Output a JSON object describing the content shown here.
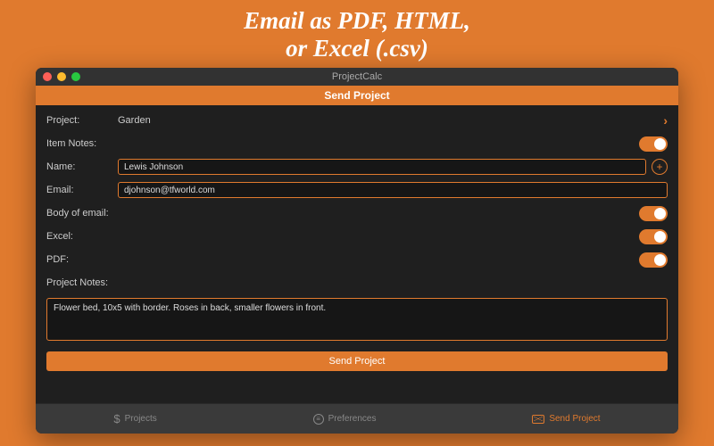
{
  "promo": {
    "line1": "Email as PDF, HTML,",
    "line2": "or Excel (.csv)"
  },
  "window": {
    "title": "ProjectCalc",
    "section_title": "Send Project"
  },
  "form": {
    "project_label": "Project:",
    "project_value": "Garden",
    "item_notes_label": "Item Notes:",
    "name_label": "Name:",
    "name_value": "Lewis Johnson",
    "email_label": "Email:",
    "email_value": "djohnson@tfworld.com",
    "body_label": "Body of email:",
    "excel_label": "Excel:",
    "pdf_label": "PDF:",
    "project_notes_label": "Project Notes:",
    "project_notes_value": "Flower bed, 10x5 with border. Roses in back, smaller flowers in front.",
    "send_button": "Send Project",
    "toggles": {
      "item_notes": true,
      "body": true,
      "excel": true,
      "pdf": true
    }
  },
  "tabs": {
    "projects": "Projects",
    "preferences": "Preferences",
    "send_project": "Send Project"
  },
  "colors": {
    "accent": "#e07a2e",
    "window_bg": "#1f1f1f"
  }
}
